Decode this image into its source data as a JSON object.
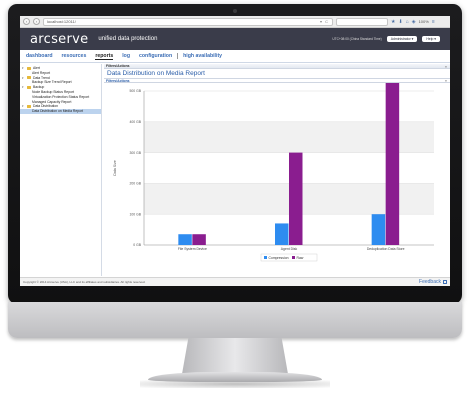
{
  "browser": {
    "url": "localhost:12011/",
    "search_placeholder": "",
    "zoom": "100%",
    "back_icon": "back-arrow-icon",
    "forward_icon": "forward-arrow-icon"
  },
  "app": {
    "logo_main": "arcserve",
    "tagline": "unified data protection",
    "timezone": "UTC+08:00 (China Standard Time)",
    "user_button": "Administrator",
    "help_button": "Help"
  },
  "nav": {
    "items": [
      {
        "label": "dashboard"
      },
      {
        "label": "resources"
      },
      {
        "label": "reports"
      },
      {
        "label": "log"
      },
      {
        "label": "configuration"
      },
      {
        "label": "high availability"
      }
    ]
  },
  "sidebar": {
    "items": [
      {
        "label": "Alert",
        "level": 1,
        "folder": true
      },
      {
        "label": "Alert Report",
        "level": 2
      },
      {
        "label": "Data Trend",
        "level": 1,
        "folder": true
      },
      {
        "label": "Backup Size Trend Report",
        "level": 2
      },
      {
        "label": "Backup",
        "level": 1,
        "folder": true
      },
      {
        "label": "Node Backup Status Report",
        "level": 2
      },
      {
        "label": "Virtualization Protection Status Report",
        "level": 2
      },
      {
        "label": "Managed Capacity Report",
        "level": 2
      },
      {
        "label": "Data Distribution",
        "level": 1,
        "folder": true
      },
      {
        "label": "Data Distribution on Media Report",
        "level": 2,
        "selected": true
      }
    ]
  },
  "main": {
    "panel_header": "Filters/Actions",
    "report_title": "Data Distribution on Media Report",
    "filters_header": "Filters/Actions"
  },
  "chart_data": {
    "type": "bar",
    "categories": [
      "File System Device",
      "Agent Disk",
      "Deduplication Data Store"
    ],
    "series": [
      {
        "name": "Compression",
        "color": "#2e8cf0",
        "values": [
          35,
          70,
          100
        ]
      },
      {
        "name": "Raw",
        "color": "#8a1d8f",
        "values": [
          35,
          300,
          590
        ]
      }
    ],
    "ylabel": "Data Size",
    "yticks": [
      "0 GB",
      "100 GB",
      "200 GB",
      "300 GB",
      "400 GB",
      "500 GB"
    ],
    "ylim": [
      0,
      500
    ],
    "grid": true,
    "legend": "bottom-center"
  },
  "footer": {
    "copyright": "Copyright © 2014 Arcserve (USA), LLC and its affiliates and subsidiaries. All rights reserved.",
    "feedback": "Feedback"
  }
}
